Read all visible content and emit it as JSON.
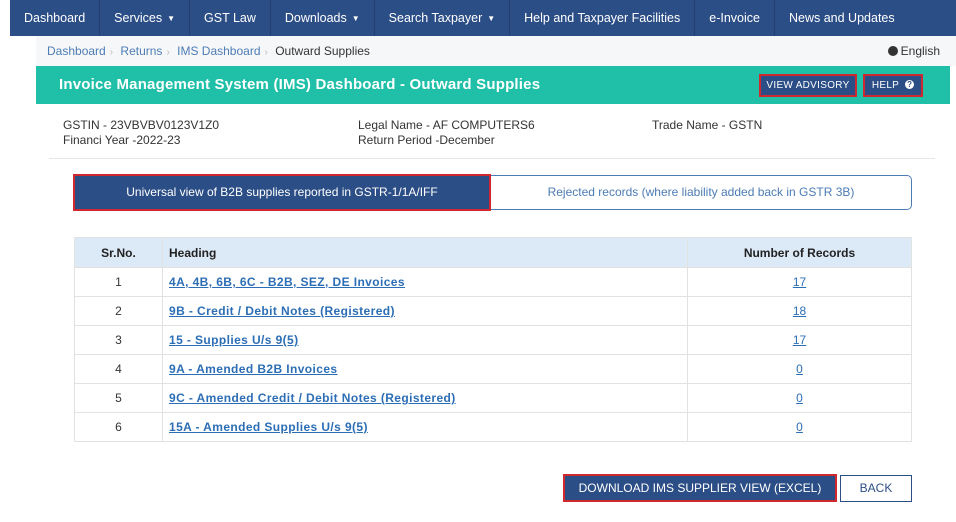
{
  "nav": {
    "items": [
      {
        "label": "Dashboard",
        "dropdown": false
      },
      {
        "label": "Services",
        "dropdown": true
      },
      {
        "label": "GST Law",
        "dropdown": false
      },
      {
        "label": "Downloads",
        "dropdown": true
      },
      {
        "label": "Search Taxpayer",
        "dropdown": true
      },
      {
        "label": "Help and Taxpayer Facilities",
        "dropdown": false
      },
      {
        "label": "e-Invoice",
        "dropdown": false
      },
      {
        "label": "News and Updates",
        "dropdown": false
      }
    ]
  },
  "breadcrumb": {
    "items": [
      "Dashboard",
      "Returns",
      "IMS Dashboard"
    ],
    "current": "Outward Supplies"
  },
  "language": "English",
  "header": {
    "title": "Invoice Management System (IMS) Dashboard - Outward Supplies",
    "advisory_label": "VIEW ADVISORY",
    "help_label": "HELP",
    "help_icon_glyph": "?"
  },
  "info": {
    "gstin": "GSTIN - 23VBVBV0123V1Z0",
    "fin_year": "Financi Year -2022-23",
    "legal_name": "Legal Name - AF COMPUTERS6",
    "return_period": "Return Period -December",
    "trade_name": "Trade Name - GSTN"
  },
  "tabs": {
    "universal": "Universal view of B2B supplies reported in GSTR-1/1A/IFF",
    "rejected": "Rejected records (where liability added back in GSTR 3B)"
  },
  "table": {
    "headers": [
      "Sr.No.",
      "Heading",
      "Number of Records"
    ],
    "rows": [
      {
        "sr": "1",
        "heading": "4A, 4B, 6B, 6C - B2B, SEZ, DE Invoices",
        "count": "17"
      },
      {
        "sr": "2",
        "heading": "9B - Credit / Debit Notes (Registered)",
        "count": "18"
      },
      {
        "sr": "3",
        "heading": "15 - Supplies U/s 9(5)",
        "count": "17"
      },
      {
        "sr": "4",
        "heading": "9A - Amended B2B Invoices",
        "count": "0"
      },
      {
        "sr": "5",
        "heading": "9C - Amended Credit / Debit Notes (Registered)",
        "count": "0"
      },
      {
        "sr": "6",
        "heading": "15A - Amended Supplies U/s 9(5)",
        "count": "0"
      }
    ]
  },
  "buttons": {
    "download": "DOWNLOAD IMS SUPPLIER VIEW (EXCEL)",
    "back": "BACK"
  },
  "colors": {
    "nav_bg": "#2c4e86",
    "header_bg": "#1fbfa8",
    "highlight_border": "#d0282f",
    "link": "#2c6eb5"
  }
}
